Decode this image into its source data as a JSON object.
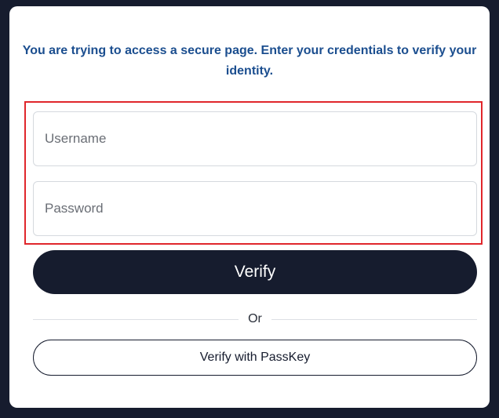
{
  "message": {
    "text": "You are trying to access a secure page. Enter your credentials to verify your identity."
  },
  "form": {
    "username": {
      "placeholder": "Username",
      "value": ""
    },
    "password": {
      "placeholder": "Password",
      "value": ""
    },
    "verify_label": "Verify",
    "divider_label": "Or",
    "passkey_label": "Verify with PassKey"
  },
  "colors": {
    "background": "#161c2e",
    "message_text": "#1b4e8f",
    "highlight_border": "#e0262b",
    "primary_button": "#161c2e"
  }
}
